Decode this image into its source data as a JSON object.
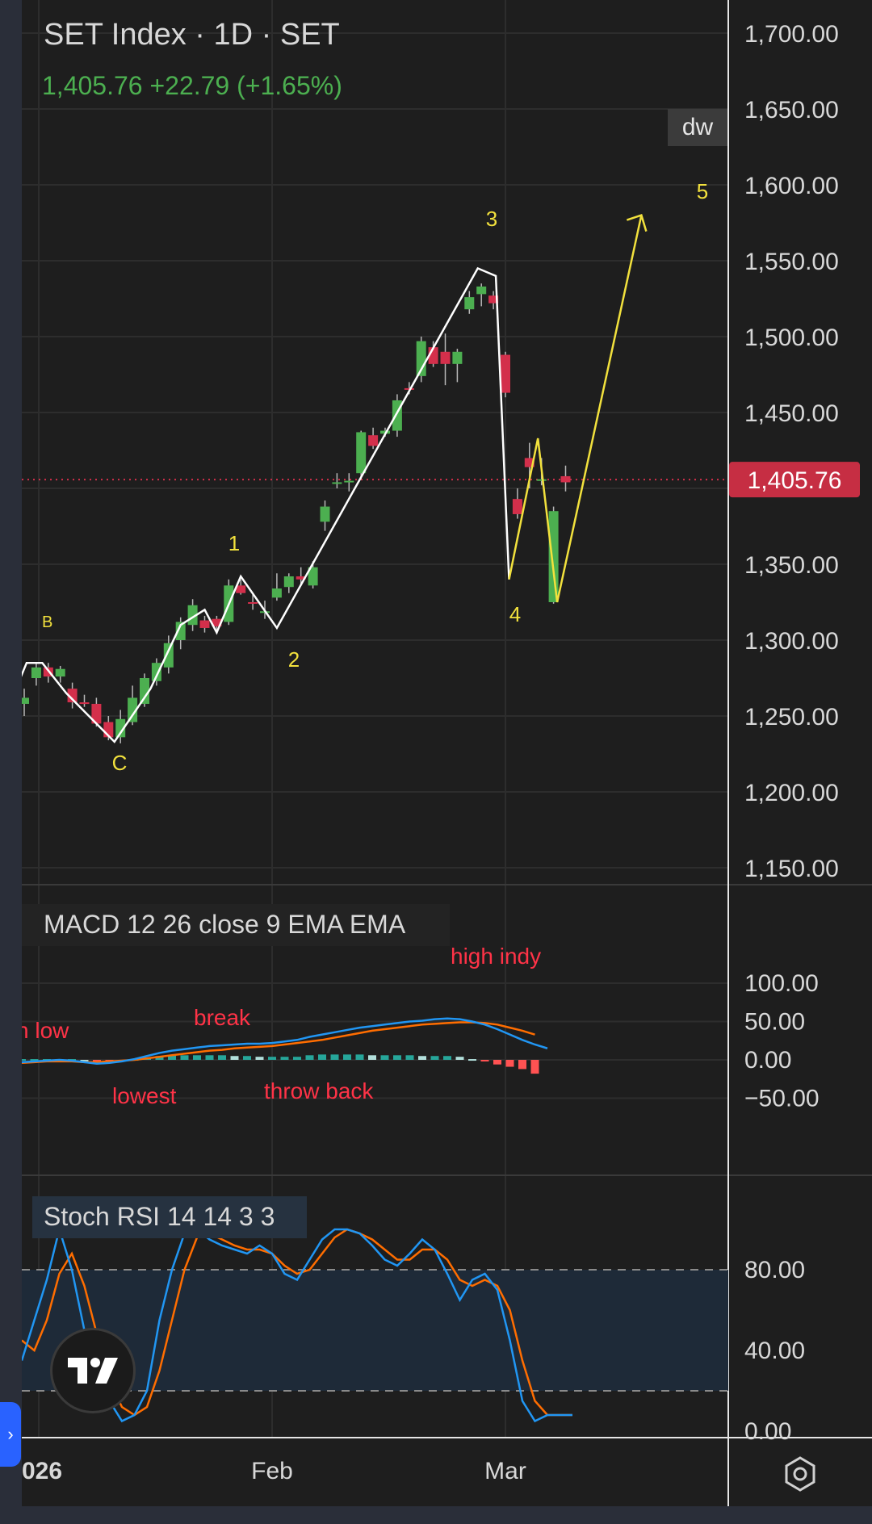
{
  "header": {
    "title": "SET Index · 1D · SET",
    "price": "1,405.76",
    "change": "+22.79 (+1.65%)"
  },
  "badges": {
    "dw": "dw",
    "current_price": "1,405.76"
  },
  "colors": {
    "background": "#1e1e1e",
    "up": "#4caf50",
    "down": "#d32f4b",
    "wave": "#ffffff",
    "projection": "#f2e13d",
    "macd_line": "#2196f3",
    "signal_line": "#ff6d00",
    "annotation": "#ff3347",
    "price_tag": "#c62e43"
  },
  "price_axis": {
    "labels": [
      "1,700.00",
      "1,650.00",
      "1,600.00",
      "1,550.00",
      "1,500.00",
      "1,450.00",
      "1,350.00",
      "1,300.00",
      "1,250.00",
      "1,200.00",
      "1,150.00"
    ]
  },
  "macd_axis": {
    "labels": [
      "100.00",
      "50.00",
      "0.00",
      "−50.00"
    ]
  },
  "stoch_axis": {
    "labels": [
      "80.00",
      "40.00",
      "0.00"
    ]
  },
  "time_axis": {
    "labels": [
      "026",
      "Feb",
      "Mar"
    ]
  },
  "wave_labels": {
    "B": "B",
    "C": "C",
    "w1": "1",
    "w2": "2",
    "w3": "3",
    "w4": "4",
    "w5": "5"
  },
  "macd": {
    "title": "MACD 12 26 close 9 EMA EMA",
    "notes": {
      "low": "n low",
      "lowest": "lowest",
      "break": "break",
      "throw_back": "throw back",
      "high_indy": "high indy"
    }
  },
  "stoch": {
    "title": "Stoch RSI 14 14 3 3"
  },
  "chart_data": [
    {
      "type": "candlestick",
      "title": "SET Index · 1D · SET",
      "ylim": [
        1150,
        1700
      ],
      "candles": [
        {
          "o": 1258,
          "h": 1268,
          "l": 1250,
          "c": 1262
        },
        {
          "o": 1275,
          "h": 1285,
          "l": 1270,
          "c": 1282
        },
        {
          "o": 1282,
          "h": 1285,
          "l": 1272,
          "c": 1276
        },
        {
          "o": 1276,
          "h": 1283,
          "l": 1272,
          "c": 1281
        },
        {
          "o": 1268,
          "h": 1272,
          "l": 1255,
          "c": 1259
        },
        {
          "o": 1259,
          "h": 1264,
          "l": 1256,
          "c": 1258
        },
        {
          "o": 1258,
          "h": 1262,
          "l": 1243,
          "c": 1245
        },
        {
          "o": 1246,
          "h": 1250,
          "l": 1234,
          "c": 1236
        },
        {
          "o": 1236,
          "h": 1254,
          "l": 1232,
          "c": 1248
        },
        {
          "o": 1246,
          "h": 1270,
          "l": 1244,
          "c": 1262
        },
        {
          "o": 1258,
          "h": 1278,
          "l": 1256,
          "c": 1275
        },
        {
          "o": 1273,
          "h": 1288,
          "l": 1270,
          "c": 1285
        },
        {
          "o": 1282,
          "h": 1303,
          "l": 1278,
          "c": 1298
        },
        {
          "o": 1300,
          "h": 1315,
          "l": 1294,
          "c": 1312
        },
        {
          "o": 1310,
          "h": 1327,
          "l": 1306,
          "c": 1323
        },
        {
          "o": 1313,
          "h": 1316,
          "l": 1305,
          "c": 1308
        },
        {
          "o": 1314,
          "h": 1316,
          "l": 1304,
          "c": 1309
        },
        {
          "o": 1312,
          "h": 1340,
          "l": 1310,
          "c": 1336
        },
        {
          "o": 1336,
          "h": 1340,
          "l": 1330,
          "c": 1331
        },
        {
          "o": 1325,
          "h": 1330,
          "l": 1320,
          "c": 1324
        },
        {
          "o": 1318,
          "h": 1326,
          "l": 1314,
          "c": 1319
        },
        {
          "o": 1328,
          "h": 1344,
          "l": 1326,
          "c": 1334
        },
        {
          "o": 1335,
          "h": 1344,
          "l": 1331,
          "c": 1342
        },
        {
          "o": 1342,
          "h": 1348,
          "l": 1336,
          "c": 1340
        },
        {
          "o": 1336,
          "h": 1352,
          "l": 1334,
          "c": 1348
        },
        {
          "o": 1378,
          "h": 1392,
          "l": 1372,
          "c": 1388
        },
        {
          "o": 1404,
          "h": 1410,
          "l": 1400,
          "c": 1404
        },
        {
          "o": 1405,
          "h": 1410,
          "l": 1398,
          "c": 1405
        },
        {
          "o": 1410,
          "h": 1438,
          "l": 1406,
          "c": 1437
        },
        {
          "o": 1435,
          "h": 1440,
          "l": 1426,
          "c": 1428
        },
        {
          "o": 1436,
          "h": 1440,
          "l": 1434,
          "c": 1438
        },
        {
          "o": 1438,
          "h": 1462,
          "l": 1434,
          "c": 1458
        },
        {
          "o": 1466,
          "h": 1470,
          "l": 1462,
          "c": 1465
        },
        {
          "o": 1474,
          "h": 1500,
          "l": 1470,
          "c": 1497
        },
        {
          "o": 1493,
          "h": 1497,
          "l": 1480,
          "c": 1482
        },
        {
          "o": 1490,
          "h": 1502,
          "l": 1468,
          "c": 1482
        },
        {
          "o": 1482,
          "h": 1492,
          "l": 1470,
          "c": 1490
        },
        {
          "o": 1518,
          "h": 1530,
          "l": 1515,
          "c": 1526
        },
        {
          "o": 1528,
          "h": 1535,
          "l": 1520,
          "c": 1533
        },
        {
          "o": 1527,
          "h": 1530,
          "l": 1518,
          "c": 1522
        },
        {
          "o": 1488,
          "h": 1490,
          "l": 1460,
          "c": 1463
        },
        {
          "o": 1393,
          "h": 1400,
          "l": 1380,
          "c": 1383
        },
        {
          "o": 1420,
          "h": 1430,
          "l": 1400,
          "c": 1414
        },
        {
          "o": 1406,
          "h": 1420,
          "l": 1402,
          "c": 1406
        },
        {
          "o": 1325,
          "h": 1388,
          "l": 1324,
          "c": 1385
        },
        {
          "o": 1408,
          "h": 1415,
          "l": 1398,
          "c": 1404
        }
      ],
      "wave_path": [
        {
          "bar": -1,
          "y": 1262
        },
        {
          "bar": 0.2,
          "y": 1285
        },
        {
          "bar": 1.5,
          "y": 1285
        },
        {
          "bar": 3.5,
          "y": 1265
        },
        {
          "bar": 7.5,
          "y": 1233
        },
        {
          "bar": 10.5,
          "y": 1268
        },
        {
          "bar": 13,
          "y": 1310
        },
        {
          "bar": 15,
          "y": 1320
        },
        {
          "bar": 16,
          "y": 1305
        },
        {
          "bar": 18,
          "y": 1342
        },
        {
          "bar": 21,
          "y": 1308
        },
        {
          "bar": 37.7,
          "y": 1545
        },
        {
          "bar": 39.2,
          "y": 1540
        },
        {
          "bar": 40.3,
          "y": 1340
        }
      ],
      "projection_path": [
        {
          "bar": 40.3,
          "y": 1340
        },
        {
          "bar": 42.7,
          "y": 1433
        },
        {
          "bar": 44.3,
          "y": 1325
        },
        {
          "bar": 51.3,
          "y": 1580
        }
      ],
      "last_price": 1405.76
    },
    {
      "type": "line",
      "title": "MACD 12 26 close 9 EMA EMA",
      "ylim": [
        -60,
        100
      ],
      "series": [
        {
          "values": [
            -3,
            -2,
            -1,
            0,
            -1,
            -3,
            -5,
            -4,
            -2,
            1,
            5,
            9,
            12,
            14,
            16,
            18,
            19,
            20,
            21,
            21,
            22,
            24,
            26,
            30,
            33,
            36,
            39,
            42,
            44,
            46,
            48,
            50,
            51,
            53,
            54,
            53,
            50,
            46,
            40,
            33,
            26,
            20,
            15
          ]
        },
        {
          "values": [
            -4,
            -3,
            -2,
            -2,
            -2,
            -3,
            -3,
            -2,
            -1,
            0,
            2,
            4,
            6,
            8,
            10,
            12,
            13,
            15,
            16,
            17,
            18,
            20,
            22,
            24,
            26,
            29,
            32,
            35,
            38,
            40,
            42,
            44,
            46,
            47,
            48,
            49,
            49,
            48,
            46,
            42,
            38,
            33
          ]
        },
        {
          "type": "bar",
          "values": [
            1,
            1,
            1,
            1,
            1,
            0,
            -2,
            -2,
            -1,
            1,
            3,
            5,
            6,
            6,
            6,
            6,
            6,
            5,
            5,
            4,
            4,
            4,
            4,
            6,
            7,
            7,
            7,
            7,
            6,
            6,
            6,
            6,
            5,
            5,
            5,
            4,
            1,
            -2,
            -6,
            -9,
            -12,
            -18
          ]
        }
      ]
    },
    {
      "type": "line",
      "title": "Stoch RSI 14 14 3 3",
      "ylim": [
        0,
        100
      ],
      "series": [
        {
          "values": [
            35,
            55,
            75,
            100,
            80,
            50,
            30,
            15,
            5,
            8,
            20,
            55,
            80,
            98,
            100,
            95,
            92,
            90,
            88,
            92,
            88,
            78,
            75,
            85,
            95,
            100,
            100,
            98,
            92,
            85,
            82,
            88,
            95,
            90,
            78,
            65,
            75,
            78,
            70,
            45,
            15,
            5,
            8,
            8,
            8
          ]
        },
        {
          "values": [
            45,
            40,
            55,
            78,
            88,
            72,
            48,
            25,
            12,
            8,
            12,
            30,
            55,
            80,
            96,
            98,
            95,
            92,
            90,
            90,
            88,
            82,
            78,
            80,
            88,
            96,
            100,
            98,
            95,
            90,
            85,
            85,
            90,
            90,
            85,
            75,
            72,
            75,
            72,
            60,
            35,
            15,
            8,
            8,
            8
          ]
        }
      ]
    }
  ]
}
